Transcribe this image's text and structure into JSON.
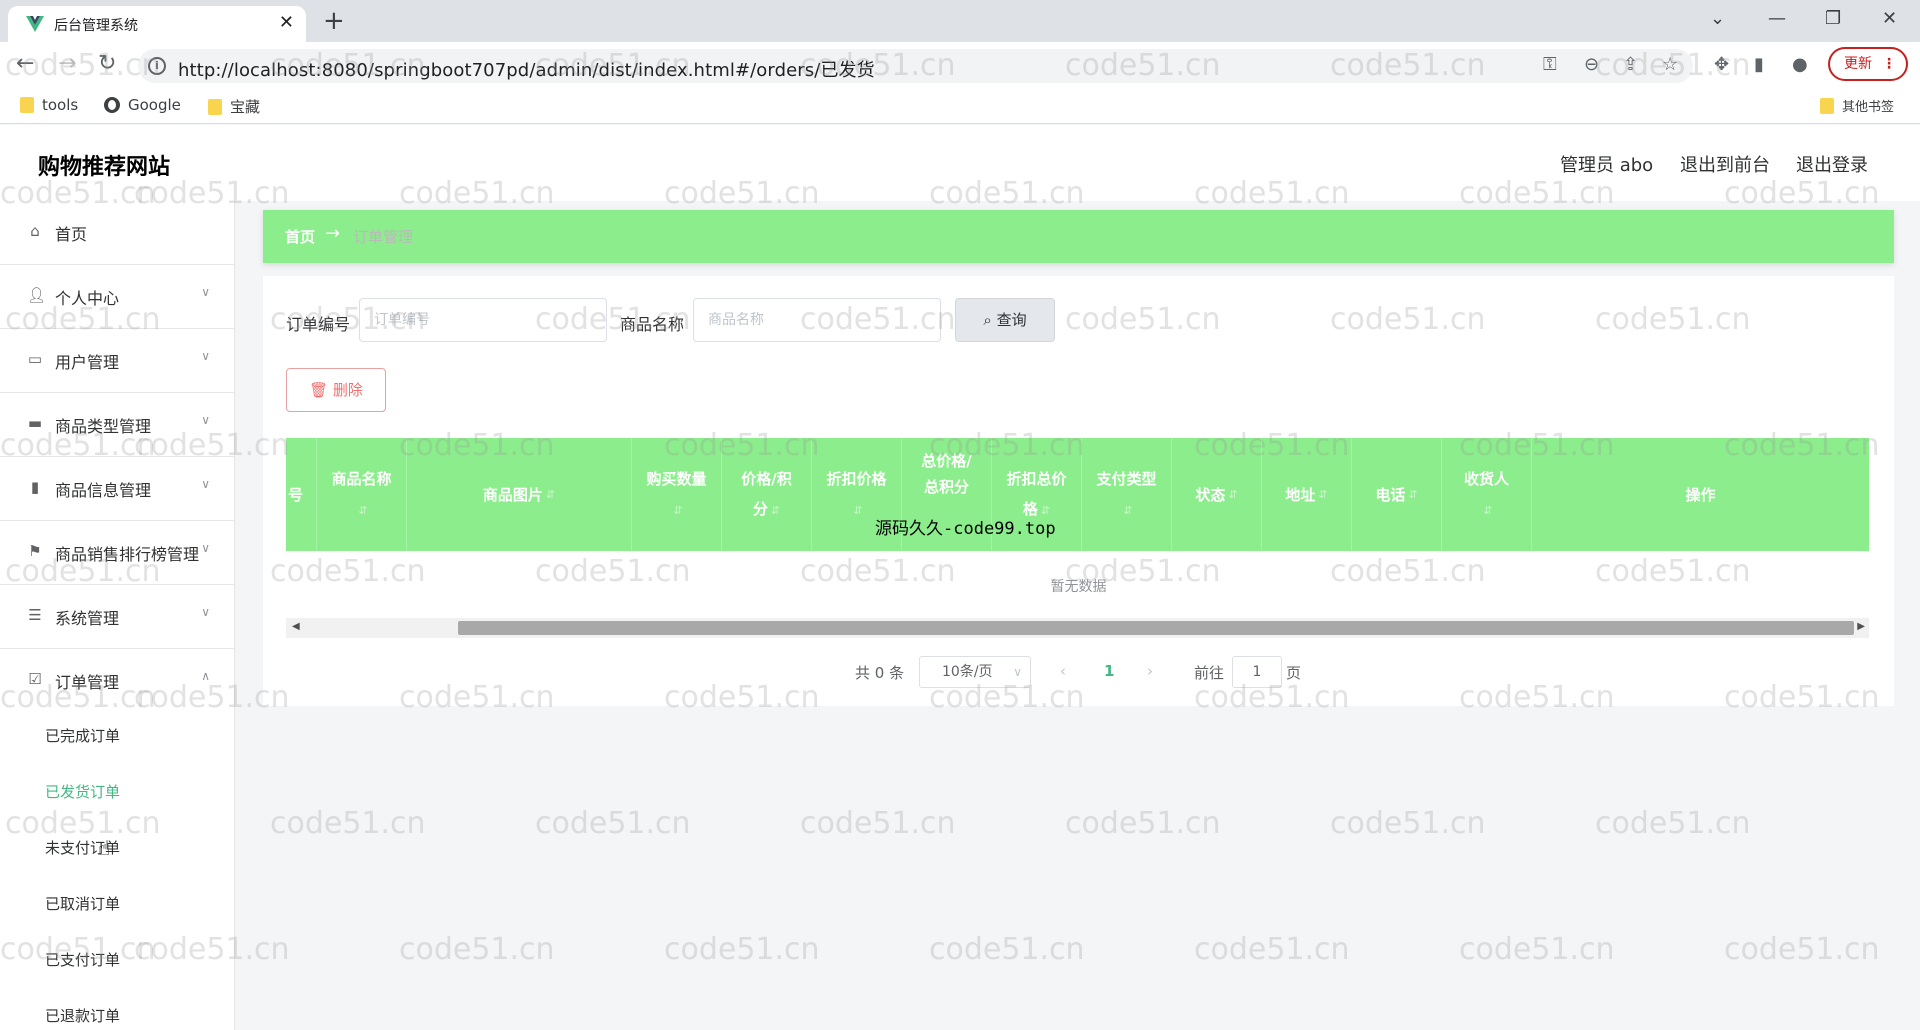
{
  "browser": {
    "tab_title": "后台管理系统",
    "url": "http://localhost:8080/springboot707pd/admin/dist/index.html#/orders/已发货",
    "update_label": "更新",
    "bookmarks": [
      "tools",
      "Google",
      "宝藏"
    ],
    "other_bookmarks": "其他书签"
  },
  "header": {
    "site_title": "购物推荐网站",
    "admin": "管理员 abo",
    "back_front": "退出到前台",
    "logout": "退出登录"
  },
  "sidebar": {
    "items": [
      {
        "label": "首页",
        "icon": "home-icon"
      },
      {
        "label": "个人中心",
        "icon": "user-icon"
      },
      {
        "label": "用户管理",
        "icon": "chat-icon"
      },
      {
        "label": "商品类型管理",
        "icon": "monitor-icon"
      },
      {
        "label": "商品信息管理",
        "icon": "bar-chart-icon"
      },
      {
        "label": "商品销售排行榜管理",
        "icon": "flag-icon"
      },
      {
        "label": "系统管理",
        "icon": "list-icon"
      },
      {
        "label": "订单管理",
        "icon": "checkbox-icon"
      }
    ],
    "order_subitems": [
      "已完成订单",
      "已发货订单",
      "未支付订单",
      "已取消订单",
      "已支付订单",
      "已退款订单"
    ],
    "active_subitem": "已发货订单"
  },
  "breadcrumb": {
    "home": "首页",
    "separator": "→",
    "current": "订单管理"
  },
  "search": {
    "order_no_label": "订单编号",
    "order_no_placeholder": "订单编号",
    "goods_name_label": "商品名称",
    "goods_name_placeholder": "商品名称",
    "query_label": "查询",
    "delete_label": "删除"
  },
  "table": {
    "columns": [
      "号",
      "商品名称",
      "商品图片",
      "购买数量",
      "价格/积分",
      "折扣价格",
      "总价格/总积分",
      "折扣总价格",
      "支付类型",
      "状态",
      "地址",
      "电话",
      "收货人",
      "操作"
    ],
    "empty_text": "暂无数据",
    "overlay_text": "源码久久-code99.top"
  },
  "pagination": {
    "total": "共 0 条",
    "page_size": "10条/页",
    "current_page": "1",
    "goto_label": "前往",
    "goto_value": "1",
    "page_suffix": "页"
  },
  "watermark": "code51.cn",
  "colors": {
    "accent_green": "#8ced8c",
    "active_text": "#42b983",
    "danger": "#f56c6c"
  }
}
